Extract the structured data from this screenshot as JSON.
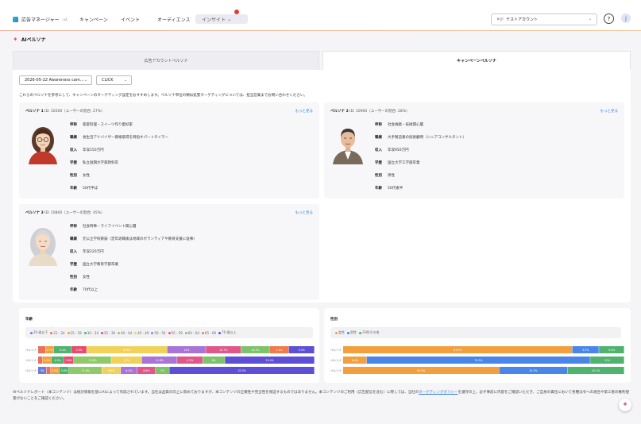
{
  "header": {
    "app_name": "広告マネージャー",
    "app_version": "v2",
    "nav": [
      "キャンペーン",
      "イベント",
      "オーディエンス"
    ],
    "active_nav": "インサイト",
    "account": "テストアカウント",
    "account_flag": "JP",
    "help_icon": "question-circle-icon",
    "user_initial": "J"
  },
  "page": {
    "title": "AIペルソナ",
    "tabs": [
      "広告アカウントペルソナ",
      "キャンペーンペルソナ"
    ],
    "active_tab": 1,
    "campaign_select": "2026-05-22 Awareness cam...",
    "metric_select": "CLICK",
    "intro": "これらのペルソナを参考にして、キャンペーンのターゲティング設定をおすすめします。ペルソナ単位の類似拡張ターゲティングについては、担当営業までお問い合わせください。",
    "more_label": "もっと見る"
  },
  "personas": [
    {
      "name": "ペルソナ 1",
      "meta": "ID: 10500（ユーザーの割合: 27%）",
      "rows": [
        {
          "k": "呼称",
          "v": "家庭料理・スイーツ作り愛好家"
        },
        {
          "k": "職業",
          "v": "食生活アドバイザー資格取得を目指すパートタイマー"
        },
        {
          "k": "収入",
          "v": "年収150万円"
        },
        {
          "k": "学歴",
          "v": "私立短期大学家政科卒"
        },
        {
          "k": "性別",
          "v": "女性"
        },
        {
          "k": "年齢",
          "v": "50代半ば"
        }
      ]
    },
    {
      "name": "ペルソナ 2",
      "meta": "ID: 10900（ユーザーの割合: 28%）",
      "rows": [
        {
          "k": "呼称",
          "v": "社会貢献・技術関心層"
        },
        {
          "k": "職業",
          "v": "大手製造業の技術顧問（シニアコンサルタント）"
        },
        {
          "k": "収入",
          "v": "年収950万円"
        },
        {
          "k": "学歴",
          "v": "国立大学工学部卒業"
        },
        {
          "k": "性別",
          "v": "男性"
        },
        {
          "k": "年齢",
          "v": "50代後半"
        }
      ]
    },
    {
      "name": "ペルソナ 3",
      "meta": "ID: 10800（ユーザーの割合: 45%）",
      "rows": [
        {
          "k": "呼称",
          "v": "社会時事・ライフイベント関心層"
        },
        {
          "k": "職業",
          "v": "元公立学校教諭（定年退職後は地域のボランティアや教育支援に従事）"
        },
        {
          "k": "収入",
          "v": "年収220万円"
        },
        {
          "k": "学歴",
          "v": "国立大学教育学部卒業"
        },
        {
          "k": "性別",
          "v": "女性"
        },
        {
          "k": "年齢",
          "v": "70代以上"
        }
      ]
    }
  ],
  "chart_data": [
    {
      "type": "bar",
      "title": "年齢",
      "legend": [
        "20 歳以下",
        "21 - 24",
        "25 - 29",
        "30 - 34",
        "35 - 39",
        "40 - 44",
        "45 - 49",
        "50 - 54",
        "55 - 59",
        "60 - 64",
        "65 - 69",
        "70 歳以上"
      ],
      "colors": [
        "#6a7fd8",
        "#e8735a",
        "#f2a03d",
        "#4fb26e",
        "#e84b6f",
        "#8fc96a",
        "#f0d25a",
        "#a874d8",
        "#e0588a",
        "#7cc36b",
        "#f07a4b",
        "#5d4fd6"
      ],
      "categories": [
        "ペルソナ 1",
        "ペルソナ 2",
        "ペルソナ 3"
      ],
      "rows": [
        [
          0,
          2.7,
          3.0,
          6.4,
          5.5,
          0,
          29.1,
          14.0,
          12.7,
          10.3,
          7.0,
          9.3
        ],
        [
          0,
          1.6,
          3.2,
          4.5,
          3.6,
          13.6,
          11.0,
          12.8,
          9.3,
          8.0,
          0,
          32.4
        ],
        [
          3.0,
          1.6,
          3.0,
          3.6,
          0,
          11.9,
          6.8,
          6.0,
          6.6,
          5.0,
          0,
          52.5
        ]
      ],
      "labels": [
        [
          "",
          "",
          "2.7%",
          "6.4%",
          "5.5%",
          "",
          "29.1%",
          "14%",
          "12.7%",
          "10.3%",
          "7.1%",
          "9.3%"
        ],
        [
          "",
          "",
          "3.2%",
          "4.5%",
          "3.6%",
          "13.6%",
          "11%",
          "12.8%",
          "9.3%",
          "8%",
          "",
          "32.4%"
        ],
        [
          "3%",
          "",
          "3.0%",
          "3.6%",
          "",
          "11.9%",
          "6.8%",
          "6.0%",
          "6.6%",
          "5%",
          "",
          "52.5%"
        ]
      ]
    },
    {
      "type": "bar",
      "title": "性別",
      "legend": [
        "女性",
        "男性",
        "不明/その他"
      ],
      "colors": [
        "#f2a03d",
        "#4a86e8",
        "#4fb26e"
      ],
      "categories": [
        "ペルソナ 1",
        "ペルソナ 2",
        "ペルソナ 3"
      ],
      "rows": [
        [
          81.5,
          9.5,
          9.0
        ],
        [
          8.4,
          79.5,
          12.1
        ],
        [
          55.5,
          24.3,
          20.2
        ]
      ],
      "labels": [
        [
          "81.5%",
          "9.5%",
          "9.0%"
        ],
        [
          "8.4%",
          "79.5%",
          "12%"
        ],
        [
          "55.5%",
          "24.3%",
          "20.2%"
        ]
      ]
    }
  ],
  "footer": {
    "text_before": "AIペルソナレポート（本コンテンツ）は統計情報を基にAIによって作成されています。当社は品質の向上に努めておりますが、本コンテンツの正確性や完全性を保証するものではありません。本コンテンツのご利用（広告配信を含む）に際しては、当社の",
    "link": "ターゲティングポリシー",
    "text_after": "を遵守の上、必ず事前に内容をご確認いただき、ご自身の責任において各種法令への適合や第三者の権利侵害がないことをご確認ください。"
  }
}
